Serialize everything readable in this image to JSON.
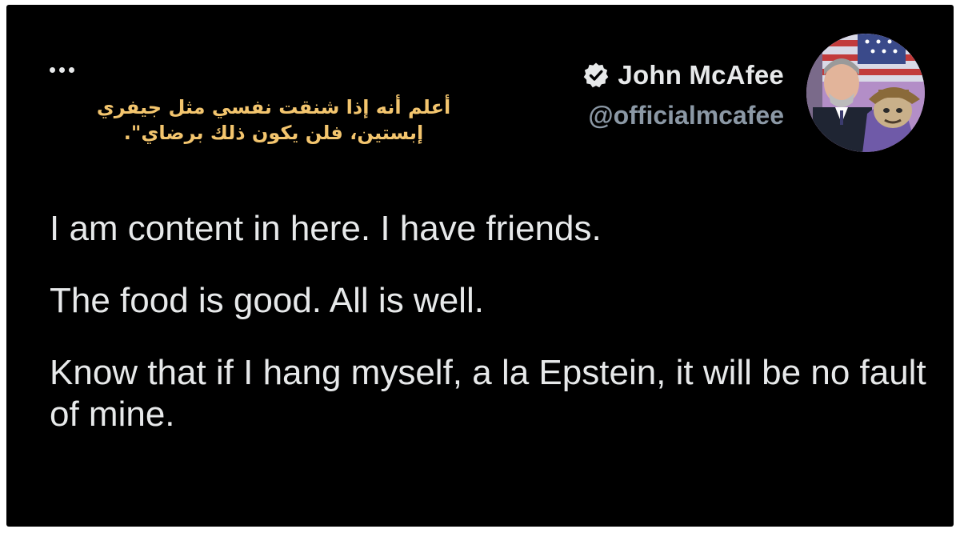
{
  "tweet": {
    "author": {
      "display_name": "John McAfee",
      "handle": "@officialmcafee",
      "verified": true,
      "verified_icon": "verified-badge-icon",
      "avatar": "avatar"
    },
    "menu_icon": "more-options-icon",
    "caption_ar": "أعلم أنه إذا شنقت نفسي مثل جيفري إبستين، فلن يكون ذلك برضاي\".",
    "paragraphs": [
      "I am content in here. I have friends.",
      "The food is good. All is well.",
      "Know that if I hang myself, a la Epstein, it will be no fault of mine."
    ]
  },
  "colors": {
    "background": "#000000",
    "primary_text": "#e7e9ea",
    "secondary_text": "#8b98a5",
    "caption": "#f3c56e"
  }
}
